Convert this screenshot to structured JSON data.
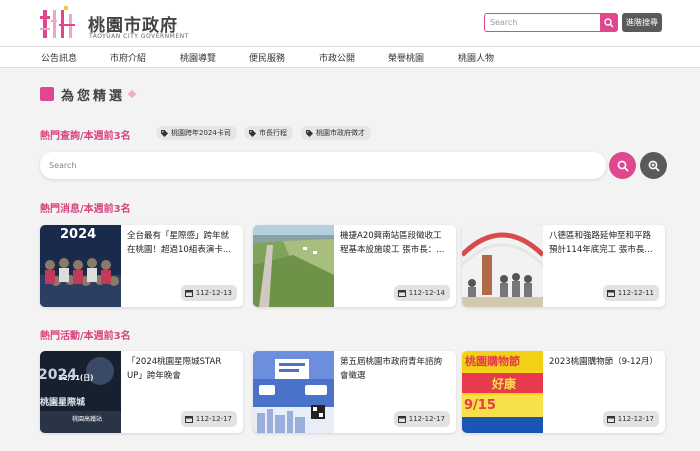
{
  "header": {
    "logo_glyph": "桃",
    "title": "桃園市政府",
    "subtitle": "TAOYUAN CITY GOVERNMENT",
    "search_placeholder": "Search",
    "advanced_search_label": "進階搜尋"
  },
  "nav": {
    "items": [
      "公告訊息",
      "市府介紹",
      "桃園導覽",
      "便民服務",
      "市政公開",
      "榮譽桃園",
      "桃園人物"
    ]
  },
  "picks": {
    "title": "為您精選"
  },
  "hot_search": {
    "title": "熱門查詢/本週前3名",
    "tags": [
      "桃園跨年2024卡司",
      "市長行程",
      "桃園市政府徵才"
    ],
    "placeholder": "Search"
  },
  "hot_news": {
    "title": "熱門消息/本週前3名",
    "cards": [
      {
        "text": "全台最有「星際感」跨年就在桃園！超過10組表演卡...",
        "date": "112-12-13",
        "thumb_text": "2024"
      },
      {
        "text": "機捷A20興南站區段徵收工程基本設施竣工 張市長：...",
        "date": "112-12-14"
      },
      {
        "text": "八德區和強路延伸至和平路預計114年底完工 張市長...",
        "date": "112-12-11"
      }
    ]
  },
  "hot_events": {
    "title": "熱門活動/本週前3名",
    "cards": [
      {
        "text": "「2024桃園星際城STAR UP」跨年晚會",
        "date": "112-12-17",
        "thumb_text": "2024",
        "thumb_date": "12/31(日)",
        "thumb_sub": "桃園星際城",
        "thumb_place": "桃園高鐵站"
      },
      {
        "text": "第五屆桃園市政府青年諮詢會徵選",
        "date": "112-12-17"
      },
      {
        "text": "2023桃園購物節（9-12月）",
        "date": "112-12-17",
        "thumb_title": "桃園購物節",
        "thumb_mid": "好康",
        "thumb_date": "9/15"
      }
    ]
  },
  "colors": {
    "accent": "#e0478f",
    "heading": "#d8437f",
    "dark_button": "#5a5a5a"
  }
}
